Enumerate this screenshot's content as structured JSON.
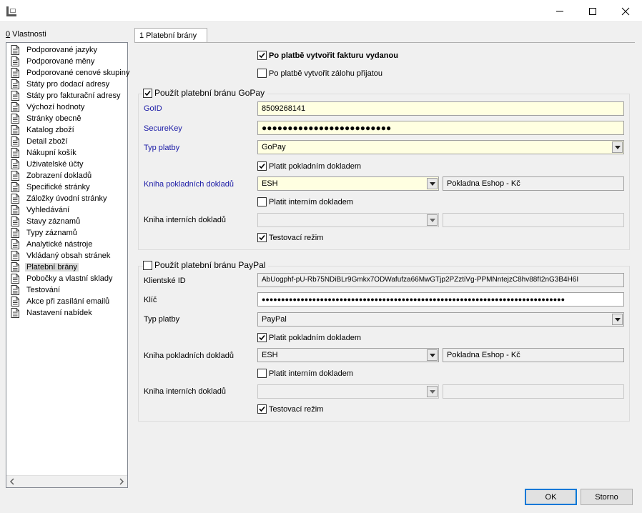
{
  "window": {
    "app_icon": "app-logo-icon",
    "min_icon": "minimize-icon",
    "max_icon": "maximize-icon",
    "close_icon": "close-icon"
  },
  "left": {
    "header_underlined": "0",
    "header_rest": " Vlastnosti",
    "items": [
      {
        "label": "Podporované jazyky"
      },
      {
        "label": "Podporované měny"
      },
      {
        "label": "Podporované cenové skupiny"
      },
      {
        "label": "Státy pro dodací adresy"
      },
      {
        "label": "Státy pro fakturační adresy"
      },
      {
        "label": "Výchozí hodnoty"
      },
      {
        "label": "Stránky obecně"
      },
      {
        "label": "Katalog zboží"
      },
      {
        "label": "Detail zboží"
      },
      {
        "label": "Nákupní košík"
      },
      {
        "label": "Uživatelské účty"
      },
      {
        "label": "Zobrazení dokladů"
      },
      {
        "label": "Specifické stránky"
      },
      {
        "label": "Záložky úvodní stránky"
      },
      {
        "label": "Vyhledávání"
      },
      {
        "label": "Stavy záznamů"
      },
      {
        "label": "Typy záznamů"
      },
      {
        "label": "Analytické nástroje"
      },
      {
        "label": "Vkládaný obsah stránek"
      },
      {
        "label": "Platební brány"
      },
      {
        "label": "Pobočky a vlastní sklady"
      },
      {
        "label": "Testování"
      },
      {
        "label": "Akce při zasílání emailů"
      },
      {
        "label": "Nastavení nabídek"
      }
    ],
    "selected_index": 19
  },
  "tab": {
    "label": "1 Platební brány"
  },
  "top": {
    "invoice_label": "Po platbě vytvořit fakturu vydanou",
    "invoice_checked": true,
    "advance_label": "Po platbě vytvořit zálohu přijatou",
    "advance_checked": false
  },
  "gopay": {
    "group_label": "Použít platební bránu GoPay",
    "enabled": true,
    "goid_label": "GoID",
    "goid_value": "8509268141",
    "secret_label": "SecureKey",
    "secret_value": "●●●●●●●●●●●●●●●●●●●●●●●●●",
    "paytype_label": "Typ platby",
    "paytype_value": "GoPay",
    "cash_doc_label": "Platit pokladním dokladem",
    "cash_doc_checked": true,
    "cash_book_label": "Kniha pokladních dokladů",
    "cash_book_value": "ESH",
    "cash_book_name": "Pokladna Eshop - Kč",
    "internal_doc_label": "Platit interním dokladem",
    "internal_doc_checked": false,
    "internal_book_label": "Kniha interních dokladů",
    "internal_book_value": "",
    "internal_book_name": "",
    "test_label": "Testovací režim",
    "test_checked": true
  },
  "paypal": {
    "group_label": "Použít platební bránu PayPal",
    "enabled": false,
    "client_label": "Klientské ID",
    "client_value": "AbUogphf-pU-Rb75NDiBLr9Gmkx7ODWafufza66MwGTjp2PZztiVg-PPMNntejzC8hv88fI2nG3B4H6I",
    "key_label": "Klíč",
    "key_value": "●●●●●●●●●●●●●●●●●●●●●●●●●●●●●●●●●●●●●●●●●●●●●●●●●●●●●●●●●●●●●●●●●●●●●●●●●●●●●●",
    "paytype_label": "Typ platby",
    "paytype_value": "PayPal",
    "cash_doc_label": "Platit pokladním dokladem",
    "cash_doc_checked": true,
    "cash_book_label": "Kniha pokladních dokladů",
    "cash_book_value": "ESH",
    "cash_book_name": "Pokladna Eshop - Kč",
    "internal_doc_label": "Platit interním dokladem",
    "internal_doc_checked": false,
    "internal_book_label": "Kniha interních dokladů",
    "internal_book_value": "",
    "internal_book_name": "",
    "test_label": "Testovací režim",
    "test_checked": true
  },
  "buttons": {
    "ok": "OK",
    "cancel": "Storno"
  },
  "colors": {
    "focus": "#0078d7",
    "required_label": "#1a1aa6",
    "required_field": "#ffffe1"
  }
}
